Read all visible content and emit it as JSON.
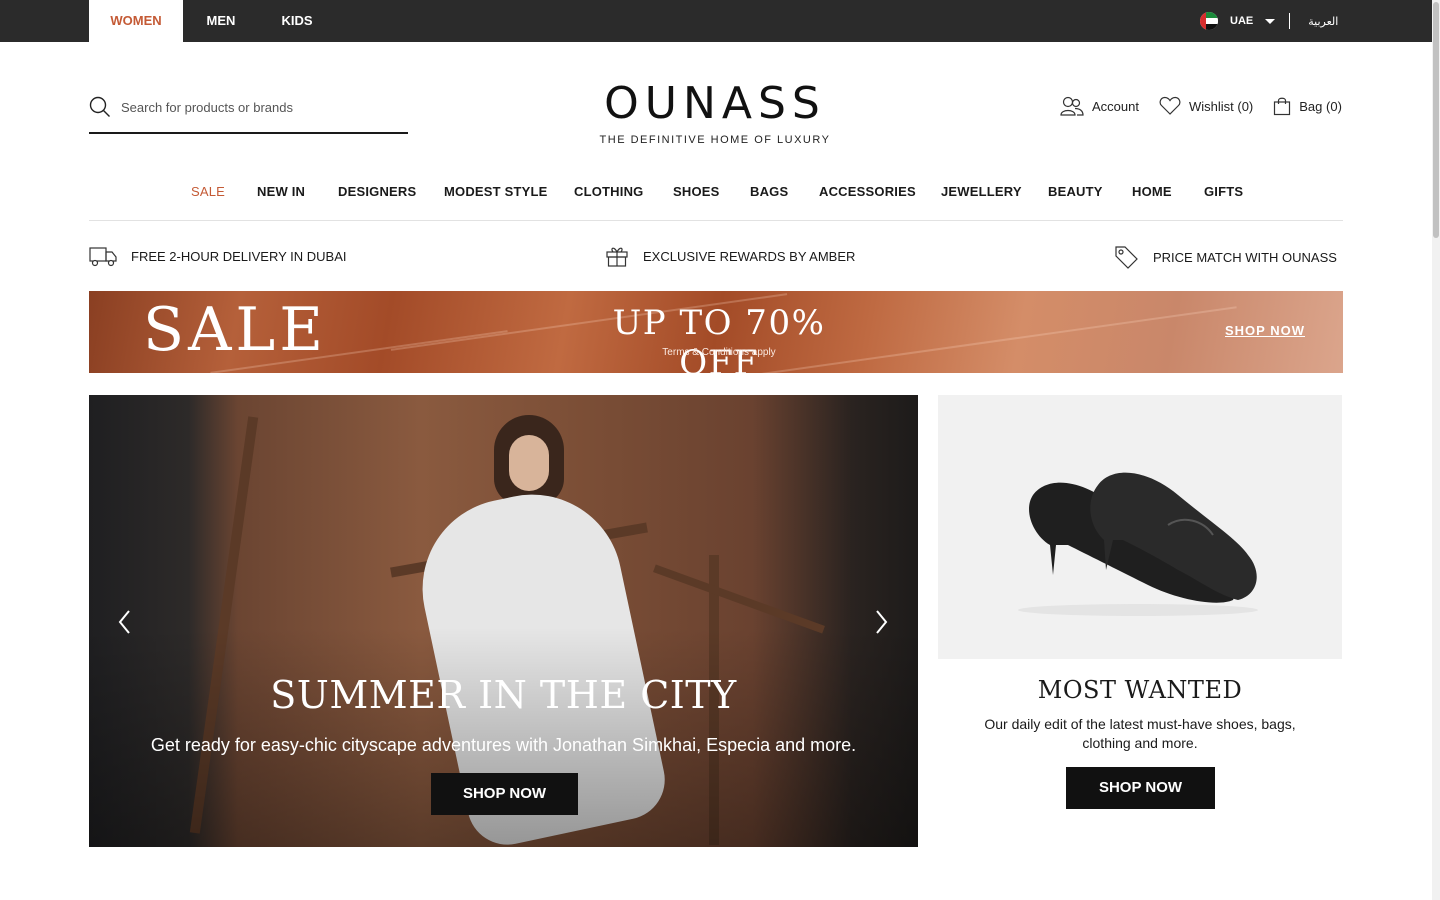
{
  "topbar": {
    "tabs": [
      {
        "label": "WOMEN",
        "active": true
      },
      {
        "label": "MEN",
        "active": false
      },
      {
        "label": "KIDS",
        "active": false
      }
    ],
    "country": "UAE",
    "language": "العربية"
  },
  "header": {
    "search_placeholder": "Search for products or brands",
    "logo": "OUNASS",
    "tagline": "THE DEFINITIVE HOME OF LUXURY",
    "account_label": "Account",
    "wishlist_label": "Wishlist (0)",
    "bag_label": "Bag (0)"
  },
  "nav": {
    "items": [
      "SALE",
      "NEW IN",
      "DESIGNERS",
      "MODEST STYLE",
      "CLOTHING",
      "SHOES",
      "BAGS",
      "ACCESSORIES",
      "JEWELLERY",
      "BEAUTY",
      "HOME",
      "GIFTS"
    ]
  },
  "usp": {
    "delivery": "FREE 2-HOUR DELIVERY IN DUBAI",
    "rewards": "EXCLUSIVE REWARDS BY AMBER",
    "price_match": "PRICE MATCH WITH OUNASS"
  },
  "banner": {
    "title": "SALE",
    "offer": "UP TO 70% OFF",
    "terms": "Terms & Conditions apply",
    "cta": "SHOP NOW"
  },
  "hero": {
    "title": "SUMMER IN THE CITY",
    "subtitle": "Get ready for easy-chic cityscape adventures with Jonathan Simkhai, Especia and more.",
    "cta": "SHOP NOW"
  },
  "promo": {
    "title": "MOST WANTED",
    "description": "Our daily edit of the latest must-have shoes, bags, clothing and more.",
    "cta": "SHOP NOW"
  },
  "colors": {
    "accent": "#c45a35",
    "topbar": "#2b2b2b",
    "button": "#111111"
  }
}
